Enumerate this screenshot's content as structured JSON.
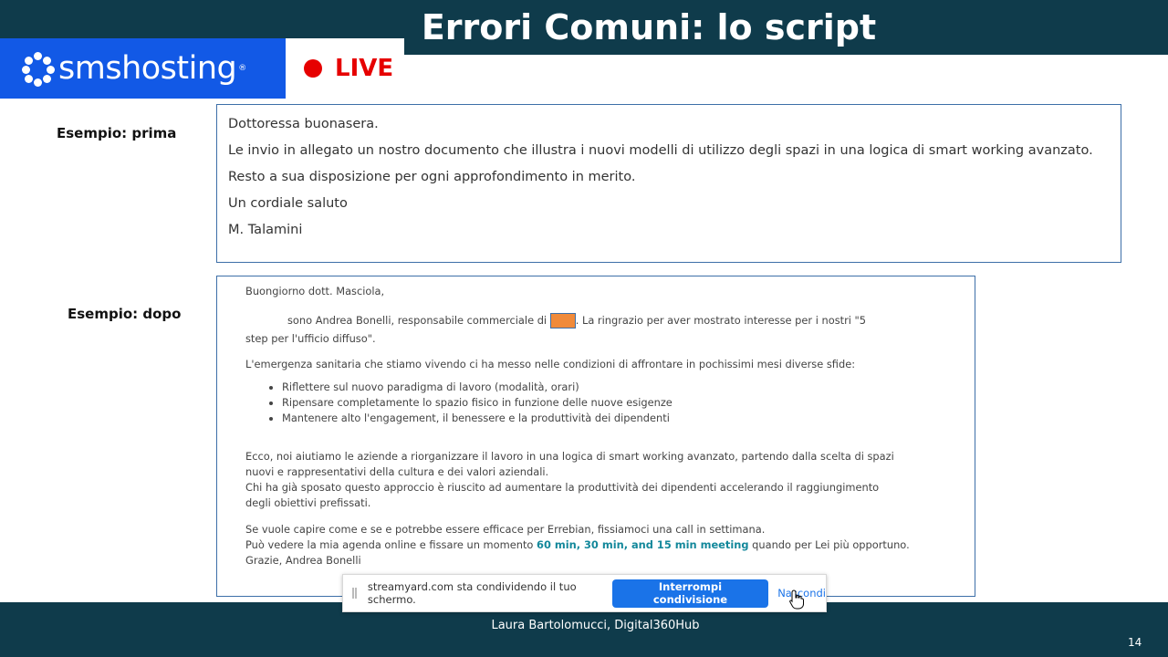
{
  "header": {
    "title": "Errori Comuni: lo script",
    "background": "#0f3b4b"
  },
  "brand": {
    "name": "smshosting",
    "registered": "®",
    "color": "#1259e6",
    "icon": "flower-dots-icon"
  },
  "live": {
    "label": "LIVE",
    "color": "#e60000",
    "icon": "red-dot-icon"
  },
  "example_before": {
    "label": "Esempio: prima",
    "lines": [
      "Dottoressa buonasera.",
      "Le invio in allegato un nostro documento che illustra i nuovi modelli di utilizzo degli spazi in una logica di smart working avanzato.",
      "Resto a sua disposizione per ogni approfondimento in merito.",
      "Un cordiale saluto",
      "M. Talamini"
    ]
  },
  "example_after": {
    "label": "Esempio: dopo",
    "greeting": "Buongiorno dott. Masciola,",
    "intro_part1": "sono Andrea Bonelli, responsabile commerciale di",
    "intro_part2": ". La ringrazio per aver mostrato interesse per i nostri \"5",
    "intro_part3": "step per l'ufficio diffuso\".",
    "context": "L'emergenza sanitaria che stiamo vivendo ci ha messo nelle condizioni di affrontare in pochissimi mesi diverse sfide:",
    "bullets": [
      "Riflettere sul nuovo paradigma di lavoro (modalità, orari)",
      "Ripensare completamente lo spazio fisico in funzione delle nuove esigenze",
      "Mantenere alto l'engagement, il benessere e la produttività dei dipendenti"
    ],
    "solution_line1": "Ecco, noi aiutiamo le aziende a riorganizzare il lavoro in una logica di smart working avanzato, partendo dalla scelta di spazi",
    "solution_line2": "nuovi e rappresentativi della cultura e dei valori aziendali.",
    "proof_line1": "Chi ha già sposato questo approccio è riuscito ad aumentare la produttività dei dipendenti accelerando il raggiungimento",
    "proof_line2": "degli obiettivi prefissati.",
    "cta_line1": "Se vuole capire come e se e potrebbe essere efficace per Errebian, fissiamoci una call in settimana.",
    "cta_line2_prefix": "Può vedere la mia agenda online e fissare un momento ",
    "cta_link": "60 min, 30 min, and 15 min meeting",
    "cta_line2_suffix": " quando per Lei più opportuno.",
    "signoff": "Grazie, Andrea Bonelli",
    "highlight_color": "#f08a3a"
  },
  "share_bar": {
    "message": "streamyard.com sta condividendo il tuo schermo.",
    "stop_label": "Interrompi condivisione",
    "hide_label": "Nascondi"
  },
  "footer": {
    "author": "Laura Bartolomucci, Digital360Hub",
    "page": "14"
  }
}
